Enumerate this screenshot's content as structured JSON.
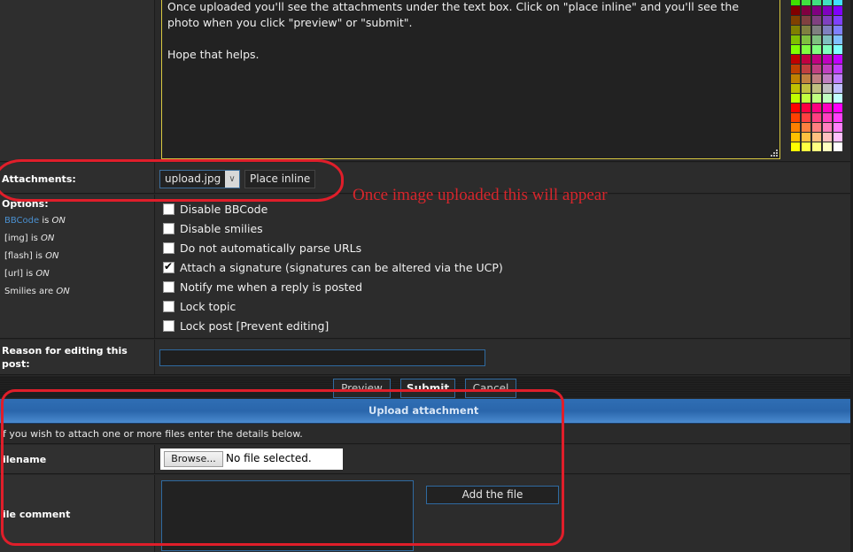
{
  "message": {
    "lines": [
      "Once uploaded you'll see the attachments under the text box. Click on \"place inline\" and you'll see the",
      "photo when you click \"preview\" or \"submit\".",
      "",
      "Hope that helps."
    ]
  },
  "palette": {
    "rows": [
      [
        "#40e000",
        "#40e040",
        "#40e080",
        "#40e0c0",
        "#40e0ff"
      ],
      [
        "#800000",
        "#800040",
        "#800080",
        "#8000c0",
        "#8000ff"
      ],
      [
        "#804000",
        "#804040",
        "#804080",
        "#8040c0",
        "#8040ff"
      ],
      [
        "#808000",
        "#808040",
        "#808080",
        "#8080c0",
        "#8080ff"
      ],
      [
        "#80c000",
        "#80c040",
        "#80c080",
        "#80c0c0",
        "#80c0ff"
      ],
      [
        "#80ff00",
        "#80ff40",
        "#80ff80",
        "#80ffc0",
        "#80ffff"
      ],
      [
        "#c00000",
        "#c00040",
        "#c00080",
        "#c000c0",
        "#c000ff"
      ],
      [
        "#c04000",
        "#c04040",
        "#c04080",
        "#c040c0",
        "#c040ff"
      ],
      [
        "#c08000",
        "#c08040",
        "#c08080",
        "#c080c0",
        "#c080ff"
      ],
      [
        "#c0c000",
        "#c0c040",
        "#c0c080",
        "#c0c0c0",
        "#c0c0ff"
      ],
      [
        "#c0ff00",
        "#c0ff40",
        "#c0ff80",
        "#c0ffc0",
        "#c0ffff"
      ],
      [
        "#ff0000",
        "#ff0040",
        "#ff0080",
        "#ff00c0",
        "#ff00ff"
      ],
      [
        "#ff4000",
        "#ff4040",
        "#ff4080",
        "#ff40c0",
        "#ff40ff"
      ],
      [
        "#ff8000",
        "#ff8040",
        "#ff8080",
        "#ff80c0",
        "#ff80ff"
      ],
      [
        "#ffc000",
        "#ffc040",
        "#ffc080",
        "#ffc0c0",
        "#ffc0ff"
      ],
      [
        "#ffff00",
        "#ffff40",
        "#ffff80",
        "#ffffc0",
        "#ffffff"
      ]
    ]
  },
  "attachments": {
    "label": "Attachments:",
    "selected": "upload.jpg",
    "place_inline": "Place inline",
    "annotation": "Once image uploaded this will appear"
  },
  "options": {
    "label": "Options:",
    "status": [
      {
        "name": "BBCode",
        "word": "is",
        "value": "ON",
        "link": true
      },
      {
        "name": "[img]",
        "word": "is",
        "value": "ON",
        "link": false
      },
      {
        "name": "[flash]",
        "word": "is",
        "value": "ON",
        "link": false
      },
      {
        "name": "[url]",
        "word": "is",
        "value": "ON",
        "link": false
      },
      {
        "name": "Smilies",
        "word": "are",
        "value": "ON",
        "link": false
      }
    ],
    "checkboxes": [
      {
        "label": "Disable BBCode",
        "checked": false
      },
      {
        "label": "Disable smilies",
        "checked": false
      },
      {
        "label": "Do not automatically parse URLs",
        "checked": false
      },
      {
        "label": "Attach a signature (signatures can be altered via the UCP)",
        "checked": true
      },
      {
        "label": "Notify me when a reply is posted",
        "checked": false
      },
      {
        "label": "Lock topic",
        "checked": false
      },
      {
        "label": "Lock post [Prevent editing]",
        "checked": false
      }
    ]
  },
  "reason": {
    "label_line1": "Reason for editing this",
    "label_line2": "post:",
    "value": ""
  },
  "buttons": {
    "preview": "Preview",
    "submit": "Submit",
    "cancel": "Cancel"
  },
  "upload": {
    "title": "Upload attachment",
    "info": "f you wish to attach one or more files enter the details below.",
    "filename_label": "ilename",
    "browse": "Browse...",
    "no_file": "No file selected.",
    "comment_label": "ile comment",
    "comment_value": "",
    "add_file": "Add the file"
  },
  "colors": {
    "accent_blue": "#2f6eb4",
    "annotation_red": "#e01e2a",
    "textarea_border": "#d8c840"
  }
}
